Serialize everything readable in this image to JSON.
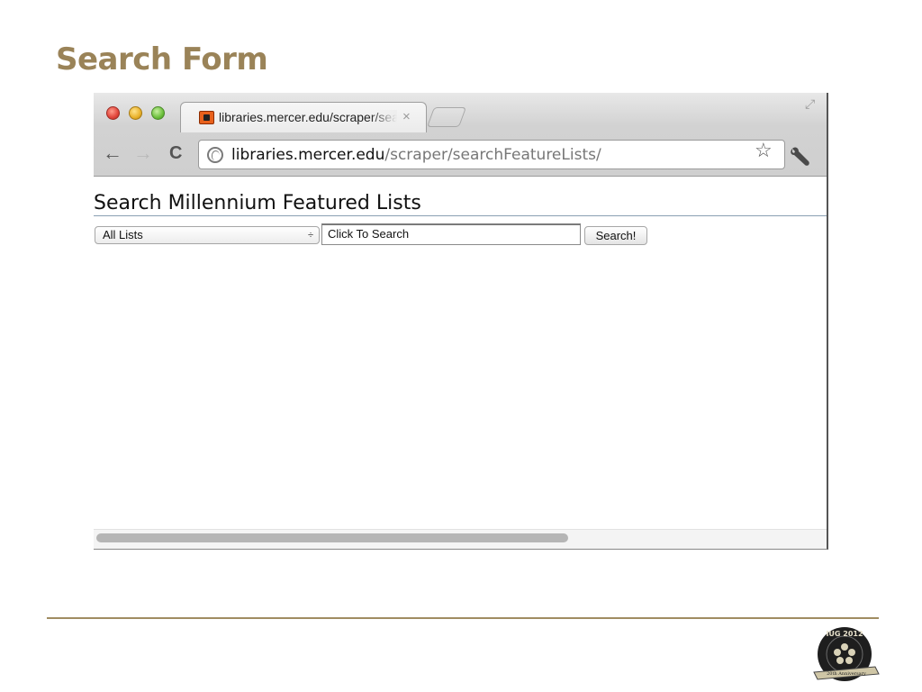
{
  "slide": {
    "title": "Search Form"
  },
  "browser": {
    "tab": {
      "title": "libraries.mercer.edu/scraper/searchFeatureLists/",
      "close_glyph": "×"
    },
    "nav": {
      "back_glyph": "←",
      "forward_glyph": "→",
      "reload_glyph": "C"
    },
    "address": {
      "host": "libraries.mercer.edu",
      "path": "/scraper/searchFeatureLists/"
    },
    "icons": [
      "close-window-icon",
      "minimize-icon",
      "zoom-icon",
      "favicon-icon",
      "resize-icon",
      "globe-icon",
      "star-icon",
      "wrench-icon"
    ]
  },
  "page": {
    "heading": "Search Millennium Featured Lists",
    "list_select": {
      "selected": "All Lists",
      "arrow_glyph": "÷"
    },
    "search_field": {
      "value": "Click To Search"
    },
    "search_button_label": "Search!"
  },
  "logo": {
    "ring_text": "IUG 2012",
    "banner_text": "20th Anniversary"
  },
  "colors": {
    "title_accent": "#9a8358",
    "rule": "#a08c62"
  }
}
